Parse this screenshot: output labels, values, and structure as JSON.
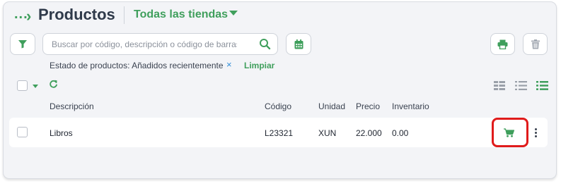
{
  "breadcrumb": {
    "ellipsis": "...",
    "separator": "›"
  },
  "header": {
    "title": "Productos",
    "store_selector": "Todas las tiendas"
  },
  "toolbar": {
    "search_placeholder": "Buscar por código, descripción o código de barras",
    "filter_icon": "funnel-icon",
    "search_icon": "magnifier-icon",
    "calendar_icon": "calendar-icon",
    "print_icon": "printer-icon",
    "delete_icon": "trash-icon"
  },
  "filter_bar": {
    "status_text": "Estado de productos: Añadidos recientemente",
    "remove_symbol": "×",
    "clear_label": "Limpiar"
  },
  "view_controls": [
    "grid-view-icon",
    "list-view-icon",
    "detail-list-view-icon"
  ],
  "table": {
    "columns": [
      "Descripción",
      "Código",
      "Unidad",
      "Precio",
      "Inventario"
    ],
    "rows": [
      {
        "description": "Libros",
        "code": "L23321",
        "unit": "XUN",
        "price": "22.000",
        "inventory": "0.00"
      }
    ]
  },
  "colors": {
    "accent": "#3f9f5c",
    "highlight": "#e01b1b",
    "link_x": "#2f8ed8"
  }
}
